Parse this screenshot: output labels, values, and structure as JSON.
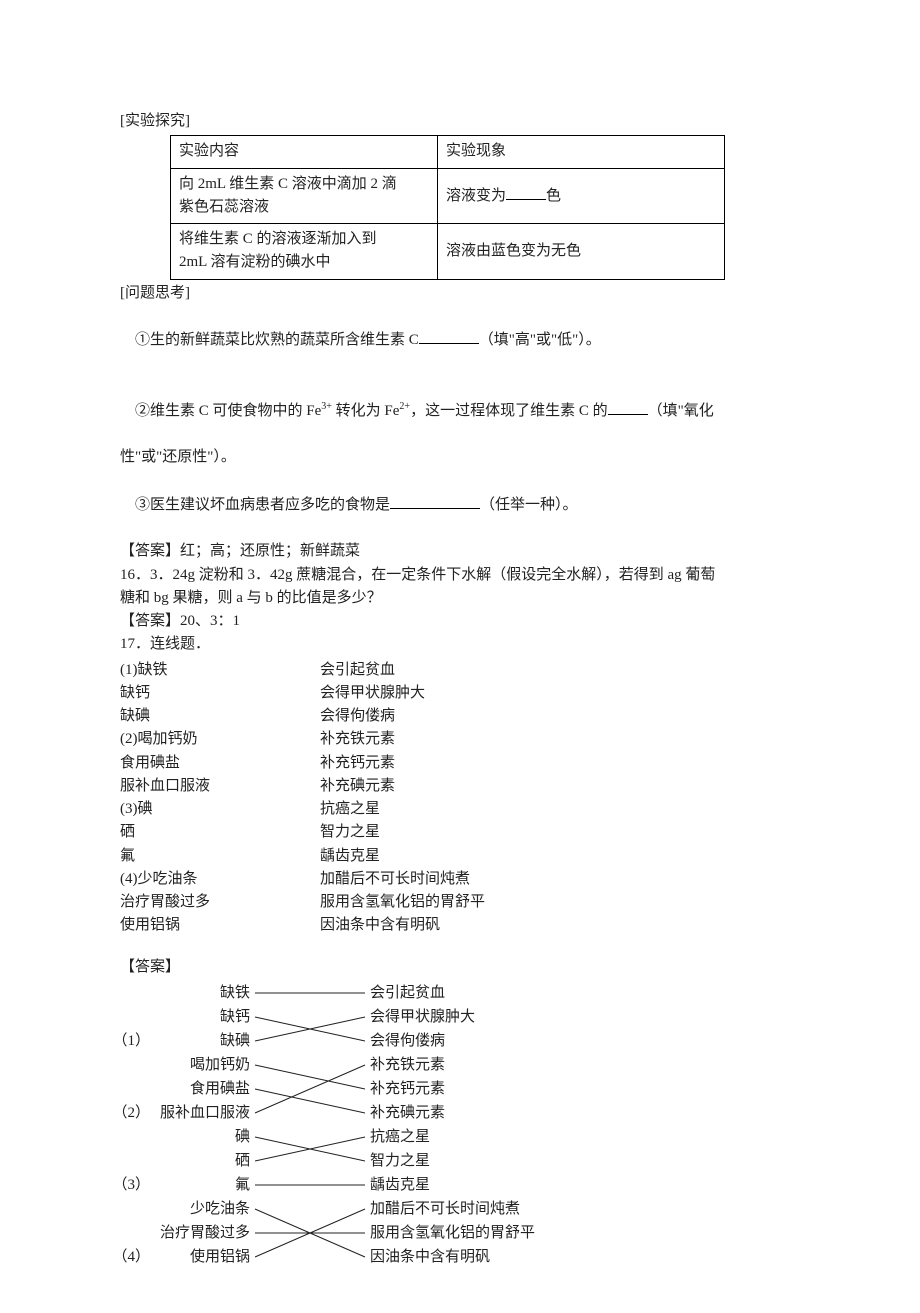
{
  "sec_experiment": {
    "label": "[实验探究]",
    "table": {
      "head_col1": "实验内容",
      "head_col2": "实验现象",
      "row1_col1_l1": "向 2mL 维生素 C 溶液中滴加 2 滴",
      "row1_col1_l2": "紫色石蕊溶液",
      "row1_col2_pre": "溶液变为",
      "row1_col2_post": "色",
      "row2_col1_l1": "将维生素 C 的溶液逐渐加入到",
      "row2_col1_l2": "2mL 溶有淀粉的碘水中",
      "row2_col2": "溶液由蓝色变为无色"
    }
  },
  "sec_thinking": {
    "label": "[问题思考]",
    "q1_pre": "①生的新鲜蔬菜比炊熟的蔬菜所含维生素 C",
    "q1_post": "（填\"高\"或\"低\"）。",
    "q2_pre": "②维生素 C 可使食物中的 Fe",
    "q2_sup1": "3+",
    "q2_mid1": " 转化为 Fe",
    "q2_sup2": "2+",
    "q2_mid2": "，这一过程体现了维生素 C 的",
    "q2_post": "（填\"氧化",
    "q2_line2": "性\"或\"还原性\"）。",
    "q3_pre": "③医生建议坏血病患者应多吃的食物是",
    "q3_post": "（任举一种）。",
    "answer_label": "【答案】红；高；还原性；新鲜蔬菜"
  },
  "q16": {
    "line1": "16．3．24g 淀粉和 3．42g 蔗糖混合，在一定条件下水解（假设完全水解），若得到 ag 葡萄",
    "line2": "糖和 bg 果糖，则 a 与 b 的比值是多少？",
    "answer": "【答案】20、3：1"
  },
  "q17": {
    "title": "17．连线题．",
    "groups": [
      {
        "left": "(1)缺铁",
        "right": "会引起贫血"
      },
      {
        "left": "缺钙",
        "right": "会得甲状腺肿大"
      },
      {
        "left": "缺碘",
        "right": "会得佝偻病"
      },
      {
        "left": "(2)喝加钙奶",
        "right": "补充铁元素"
      },
      {
        "left": "食用碘盐",
        "right": "补充钙元素"
      },
      {
        "left": "服补血口服液",
        "right": "补充碘元素"
      },
      {
        "left": "(3)碘",
        "right": "抗癌之星"
      },
      {
        "left": "硒",
        "right": "智力之星"
      },
      {
        "left": "氟",
        "right": "龋齿克星"
      },
      {
        "left": "(4)少吃油条",
        "right": "加醋后不可长时间炖煮"
      },
      {
        "left": "治疗胃酸过多",
        "right": "服用含氢氧化铝的胃舒平"
      },
      {
        "left": "使用铝锅",
        "right": "因油条中含有明矾"
      }
    ],
    "answer_label": "【答案】"
  },
  "answer_matching": {
    "marker1": "（1）",
    "marker2": "（2）",
    "marker3": "（3）",
    "marker4": "（4）",
    "left": [
      "缺铁",
      "缺钙",
      "缺碘",
      "喝加钙奶",
      "食用碘盐",
      "服补血口服液",
      "碘",
      "硒",
      "氟",
      "少吃油条",
      "治疗胃酸过多",
      "使用铝锅"
    ],
    "right": [
      "会引起贫血",
      "会得甲状腺肿大",
      "会得佝偻病",
      "补充铁元素",
      "补充钙元素",
      "补充碘元素",
      "抗癌之星",
      "智力之星",
      "龋齿克星",
      "加醋后不可长时间炖煮",
      "服用含氢氧化铝的胃舒平",
      "因油条中含有明矾"
    ]
  }
}
